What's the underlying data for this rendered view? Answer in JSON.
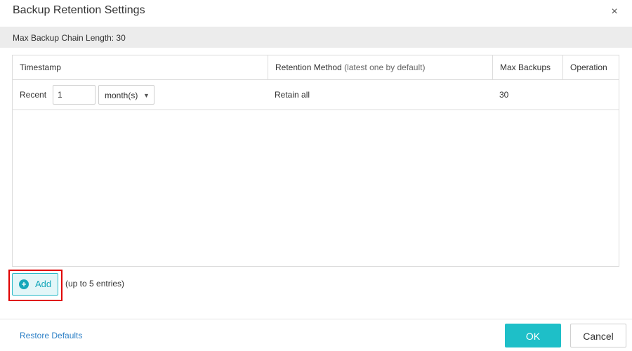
{
  "dialog": {
    "title": "Backup Retention Settings",
    "close_icon": "close-icon",
    "close_glyph": "×"
  },
  "chain_bar": {
    "text": "Max Backup Chain Length: 30"
  },
  "table": {
    "headers": {
      "timestamp": "Timestamp",
      "retention_method": "Retention Method",
      "retention_method_note": "(latest one by default)",
      "max_backups": "Max Backups",
      "operation": "Operation"
    },
    "rows": [
      {
        "recent_label": "Recent",
        "amount_value": "1",
        "unit_value": "month(s)",
        "retention_method": "Retain all",
        "max_backups": "30",
        "operation": ""
      }
    ]
  },
  "add": {
    "label": "Add",
    "icon": "plus-circle-icon",
    "hint": "(up to 5 entries)"
  },
  "footer": {
    "restore_label": "Restore Defaults",
    "ok_label": "OK",
    "cancel_label": "Cancel"
  },
  "colors": {
    "accent": "#1ebfc8",
    "add_text": "#16a7ba",
    "link": "#2b7fc6",
    "highlight": "#e00000"
  }
}
